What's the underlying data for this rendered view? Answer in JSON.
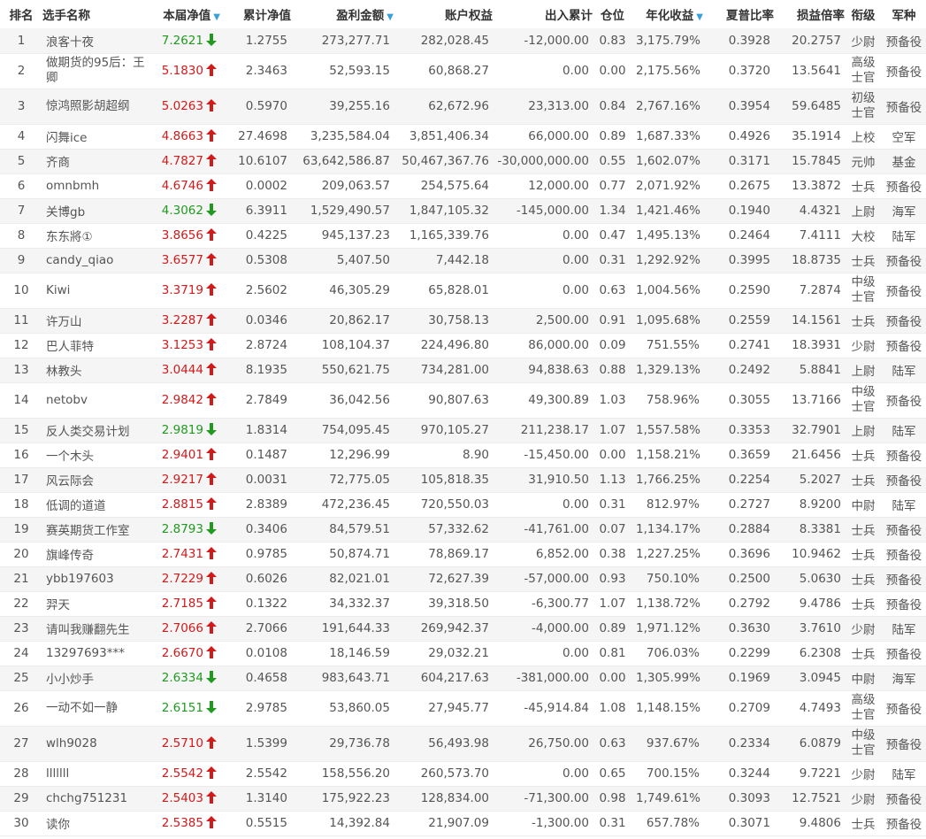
{
  "headers": {
    "rank": "排名",
    "name": "选手名称",
    "nav": "本届净值",
    "cum_nav": "累计净值",
    "profit": "盈利金额",
    "equity": "账户权益",
    "flow": "出入累计",
    "position": "仓位",
    "annual": "年化收益",
    "sharpe": "夏普比率",
    "pl_ratio": "损益倍率",
    "grade": "衔级",
    "branch": "军种"
  },
  "sort_icon": "triangle-down",
  "colors": {
    "up": "#d11a1a",
    "down": "#1f9a1f",
    "sort": "#3aa0d8"
  },
  "rows": [
    {
      "rank": "1",
      "name": "浪客十夜",
      "nav": "7.2621",
      "trend": "down",
      "cum_nav": "1.2755",
      "profit": "273,277.71",
      "equity": "282,028.45",
      "flow": "-12,000.00",
      "position": "0.83",
      "annual": "3,175.79%",
      "sharpe": "0.3928",
      "pl_ratio": "20.2757",
      "grade": "少尉",
      "branch": "预备役"
    },
    {
      "rank": "2",
      "name": "做期货的95后：王卿",
      "nav": "5.1830",
      "trend": "up",
      "cum_nav": "2.3463",
      "profit": "52,593.15",
      "equity": "60,868.27",
      "flow": "0.00",
      "position": "0.00",
      "annual": "2,175.56%",
      "sharpe": "0.3720",
      "pl_ratio": "13.5641",
      "grade": "高级士官",
      "branch": "预备役"
    },
    {
      "rank": "3",
      "name": "惊鸿照影胡超纲",
      "nav": "5.0263",
      "trend": "up",
      "cum_nav": "0.5970",
      "profit": "39,255.16",
      "equity": "62,672.96",
      "flow": "23,313.00",
      "position": "0.84",
      "annual": "2,767.16%",
      "sharpe": "0.3954",
      "pl_ratio": "59.6485",
      "grade": "初级士官",
      "branch": "预备役"
    },
    {
      "rank": "4",
      "name": "闪舞ice",
      "nav": "4.8663",
      "trend": "up",
      "cum_nav": "27.4698",
      "profit": "3,235,584.04",
      "equity": "3,851,406.34",
      "flow": "66,000.00",
      "position": "0.89",
      "annual": "1,687.33%",
      "sharpe": "0.4926",
      "pl_ratio": "35.1914",
      "grade": "上校",
      "branch": "空军"
    },
    {
      "rank": "5",
      "name": "齐商",
      "nav": "4.7827",
      "trend": "up",
      "cum_nav": "10.6107",
      "profit": "63,642,586.87",
      "equity": "50,467,367.76",
      "flow": "-30,000,000.00",
      "position": "0.55",
      "annual": "1,602.07%",
      "sharpe": "0.3171",
      "pl_ratio": "15.7845",
      "grade": "元帅",
      "branch": "基金"
    },
    {
      "rank": "6",
      "name": "omnbmh",
      "nav": "4.6746",
      "trend": "up",
      "cum_nav": "0.0002",
      "profit": "209,063.57",
      "equity": "254,575.64",
      "flow": "12,000.00",
      "position": "0.77",
      "annual": "2,071.92%",
      "sharpe": "0.2675",
      "pl_ratio": "13.3872",
      "grade": "士兵",
      "branch": "预备役"
    },
    {
      "rank": "7",
      "name": "关博gb",
      "nav": "4.3062",
      "trend": "down",
      "cum_nav": "6.3911",
      "profit": "1,529,490.57",
      "equity": "1,847,105.32",
      "flow": "-145,000.00",
      "position": "1.34",
      "annual": "1,421.46%",
      "sharpe": "0.1940",
      "pl_ratio": "4.4321",
      "grade": "上尉",
      "branch": "海军"
    },
    {
      "rank": "8",
      "name": "东东將①",
      "nav": "3.8656",
      "trend": "up",
      "cum_nav": "0.4225",
      "profit": "945,137.23",
      "equity": "1,165,339.76",
      "flow": "0.00",
      "position": "0.47",
      "annual": "1,495.13%",
      "sharpe": "0.2464",
      "pl_ratio": "7.4111",
      "grade": "大校",
      "branch": "陆军"
    },
    {
      "rank": "9",
      "name": "candy_qiao",
      "nav": "3.6577",
      "trend": "up",
      "cum_nav": "0.5308",
      "profit": "5,407.50",
      "equity": "7,442.18",
      "flow": "0.00",
      "position": "0.31",
      "annual": "1,292.92%",
      "sharpe": "0.3995",
      "pl_ratio": "18.8735",
      "grade": "士兵",
      "branch": "预备役"
    },
    {
      "rank": "10",
      "name": "Kiwi",
      "nav": "3.3719",
      "trend": "up",
      "cum_nav": "2.5602",
      "profit": "46,305.29",
      "equity": "65,828.01",
      "flow": "0.00",
      "position": "0.63",
      "annual": "1,004.56%",
      "sharpe": "0.2590",
      "pl_ratio": "7.2874",
      "grade": "中级士官",
      "branch": "预备役"
    },
    {
      "rank": "11",
      "name": "许万山",
      "nav": "3.2287",
      "trend": "up",
      "cum_nav": "0.0346",
      "profit": "20,862.17",
      "equity": "30,758.13",
      "flow": "2,500.00",
      "position": "0.91",
      "annual": "1,095.68%",
      "sharpe": "0.2559",
      "pl_ratio": "14.1561",
      "grade": "士兵",
      "branch": "预备役"
    },
    {
      "rank": "12",
      "name": "巴人菲特",
      "nav": "3.1253",
      "trend": "up",
      "cum_nav": "2.8724",
      "profit": "108,104.37",
      "equity": "224,496.80",
      "flow": "86,000.00",
      "position": "0.09",
      "annual": "751.55%",
      "sharpe": "0.2741",
      "pl_ratio": "18.3931",
      "grade": "少尉",
      "branch": "预备役"
    },
    {
      "rank": "13",
      "name": "林教头",
      "nav": "3.0444",
      "trend": "up",
      "cum_nav": "8.1935",
      "profit": "550,621.75",
      "equity": "734,281.00",
      "flow": "94,838.63",
      "position": "0.88",
      "annual": "1,329.13%",
      "sharpe": "0.2492",
      "pl_ratio": "5.8841",
      "grade": "上尉",
      "branch": "陆军"
    },
    {
      "rank": "14",
      "name": "netobv",
      "nav": "2.9842",
      "trend": "up",
      "cum_nav": "2.7849",
      "profit": "36,042.56",
      "equity": "90,807.63",
      "flow": "49,300.89",
      "position": "1.03",
      "annual": "758.96%",
      "sharpe": "0.3055",
      "pl_ratio": "13.7166",
      "grade": "中级士官",
      "branch": "预备役"
    },
    {
      "rank": "15",
      "name": "反人类交易计划",
      "nav": "2.9819",
      "trend": "down",
      "cum_nav": "1.8314",
      "profit": "754,095.45",
      "equity": "970,105.27",
      "flow": "211,238.17",
      "position": "1.07",
      "annual": "1,557.58%",
      "sharpe": "0.3353",
      "pl_ratio": "32.7901",
      "grade": "上尉",
      "branch": "陆军"
    },
    {
      "rank": "16",
      "name": "一个木头",
      "nav": "2.9401",
      "trend": "up",
      "cum_nav": "0.1487",
      "profit": "12,296.99",
      "equity": "8.90",
      "flow": "-15,450.00",
      "position": "0.00",
      "annual": "1,158.21%",
      "sharpe": "0.3659",
      "pl_ratio": "21.6456",
      "grade": "士兵",
      "branch": "预备役"
    },
    {
      "rank": "17",
      "name": "风云际会",
      "nav": "2.9217",
      "trend": "up",
      "cum_nav": "0.0031",
      "profit": "72,775.05",
      "equity": "105,818.35",
      "flow": "31,910.50",
      "position": "1.13",
      "annual": "1,766.25%",
      "sharpe": "0.2254",
      "pl_ratio": "5.2027",
      "grade": "士兵",
      "branch": "预备役"
    },
    {
      "rank": "18",
      "name": "低调的道道",
      "nav": "2.8815",
      "trend": "up",
      "cum_nav": "2.8389",
      "profit": "472,236.45",
      "equity": "720,550.03",
      "flow": "0.00",
      "position": "0.31",
      "annual": "812.97%",
      "sharpe": "0.2727",
      "pl_ratio": "8.9200",
      "grade": "中尉",
      "branch": "陆军"
    },
    {
      "rank": "19",
      "name": "赛英期货工作室",
      "nav": "2.8793",
      "trend": "down",
      "cum_nav": "0.3406",
      "profit": "84,579.51",
      "equity": "57,332.62",
      "flow": "-41,761.00",
      "position": "0.07",
      "annual": "1,134.17%",
      "sharpe": "0.2884",
      "pl_ratio": "8.3381",
      "grade": "士兵",
      "branch": "预备役"
    },
    {
      "rank": "20",
      "name": "旗峰传奇",
      "nav": "2.7431",
      "trend": "up",
      "cum_nav": "0.9785",
      "profit": "50,874.71",
      "equity": "78,869.17",
      "flow": "6,852.00",
      "position": "0.38",
      "annual": "1,227.25%",
      "sharpe": "0.3696",
      "pl_ratio": "10.9462",
      "grade": "士兵",
      "branch": "预备役"
    },
    {
      "rank": "21",
      "name": "ybb197603",
      "nav": "2.7229",
      "trend": "up",
      "cum_nav": "0.6026",
      "profit": "82,021.01",
      "equity": "72,627.39",
      "flow": "-57,000.00",
      "position": "0.93",
      "annual": "750.10%",
      "sharpe": "0.2500",
      "pl_ratio": "5.0630",
      "grade": "士兵",
      "branch": "预备役"
    },
    {
      "rank": "22",
      "name": "羿天",
      "nav": "2.7185",
      "trend": "up",
      "cum_nav": "0.1322",
      "profit": "34,332.37",
      "equity": "39,318.50",
      "flow": "-6,300.77",
      "position": "1.07",
      "annual": "1,138.72%",
      "sharpe": "0.2792",
      "pl_ratio": "9.4786",
      "grade": "士兵",
      "branch": "预备役"
    },
    {
      "rank": "23",
      "name": "请叫我赚翻先生",
      "nav": "2.7066",
      "trend": "up",
      "cum_nav": "2.7066",
      "profit": "191,644.33",
      "equity": "269,942.37",
      "flow": "-4,000.00",
      "position": "0.89",
      "annual": "1,971.12%",
      "sharpe": "0.3630",
      "pl_ratio": "3.7610",
      "grade": "少尉",
      "branch": "陆军"
    },
    {
      "rank": "24",
      "name": "13297693***",
      "nav": "2.6670",
      "trend": "up",
      "cum_nav": "0.0108",
      "profit": "18,146.59",
      "equity": "29,032.21",
      "flow": "0.00",
      "position": "0.81",
      "annual": "706.03%",
      "sharpe": "0.2299",
      "pl_ratio": "6.2308",
      "grade": "士兵",
      "branch": "预备役"
    },
    {
      "rank": "25",
      "name": "小小炒手",
      "nav": "2.6334",
      "trend": "down",
      "cum_nav": "0.4658",
      "profit": "983,643.71",
      "equity": "604,217.63",
      "flow": "-381,000.00",
      "position": "0.00",
      "annual": "1,305.99%",
      "sharpe": "0.1969",
      "pl_ratio": "3.0945",
      "grade": "中尉",
      "branch": "海军"
    },
    {
      "rank": "26",
      "name": "一动不如一静",
      "nav": "2.6151",
      "trend": "down",
      "cum_nav": "2.9785",
      "profit": "53,860.05",
      "equity": "27,945.77",
      "flow": "-45,914.84",
      "position": "1.08",
      "annual": "1,148.15%",
      "sharpe": "0.2709",
      "pl_ratio": "4.7493",
      "grade": "高级士官",
      "branch": "预备役"
    },
    {
      "rank": "27",
      "name": "wlh9028",
      "nav": "2.5710",
      "trend": "up",
      "cum_nav": "1.5399",
      "profit": "29,736.78",
      "equity": "56,493.98",
      "flow": "26,750.00",
      "position": "0.63",
      "annual": "937.67%",
      "sharpe": "0.2334",
      "pl_ratio": "6.0879",
      "grade": "中级士官",
      "branch": "预备役"
    },
    {
      "rank": "28",
      "name": "lllllll",
      "nav": "2.5542",
      "trend": "up",
      "cum_nav": "2.5542",
      "profit": "158,556.20",
      "equity": "260,573.70",
      "flow": "0.00",
      "position": "0.65",
      "annual": "700.15%",
      "sharpe": "0.3244",
      "pl_ratio": "9.7221",
      "grade": "少尉",
      "branch": "陆军"
    },
    {
      "rank": "29",
      "name": "chchg751231",
      "nav": "2.5403",
      "trend": "up",
      "cum_nav": "1.3140",
      "profit": "175,922.23",
      "equity": "128,834.00",
      "flow": "-71,300.00",
      "position": "0.98",
      "annual": "1,749.61%",
      "sharpe": "0.3093",
      "pl_ratio": "12.7521",
      "grade": "少尉",
      "branch": "预备役"
    },
    {
      "rank": "30",
      "name": "读你",
      "nav": "2.5385",
      "trend": "up",
      "cum_nav": "0.5515",
      "profit": "14,392.84",
      "equity": "21,907.09",
      "flow": "-1,300.00",
      "position": "0.31",
      "annual": "657.78%",
      "sharpe": "0.3071",
      "pl_ratio": "9.4806",
      "grade": "士兵",
      "branch": "预备役"
    }
  ]
}
